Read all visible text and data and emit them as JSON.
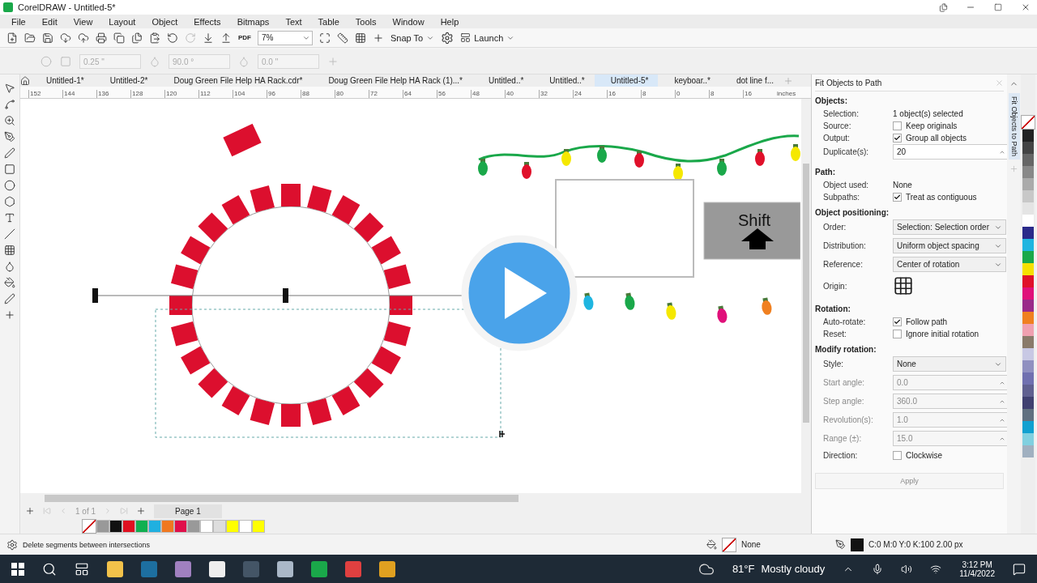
{
  "window": {
    "title": "CorelDRAW - Untitled-5*"
  },
  "menu": [
    "File",
    "Edit",
    "View",
    "Layout",
    "Object",
    "Effects",
    "Bitmaps",
    "Text",
    "Table",
    "Tools",
    "Window",
    "Help"
  ],
  "toolbar": {
    "pdf_label": "PDF",
    "zoom": "7%",
    "snap": "Snap To",
    "launch": "Launch"
  },
  "property_bar": {
    "outline_width": "0.25 \"",
    "angle": "90.0 °",
    "offset": "0.0 \""
  },
  "document_tabs": [
    {
      "label": "Untitled-1*",
      "selected": false
    },
    {
      "label": "Untitled-2*",
      "selected": false
    },
    {
      "label": "Doug Green File Help HA Rack.cdr*",
      "selected": false
    },
    {
      "label": "Doug Green File Help HA Rack (1)...*",
      "selected": false
    },
    {
      "label": "Untitled..*",
      "selected": false
    },
    {
      "label": "Untitled..*",
      "selected": false
    },
    {
      "label": "Untitled-5*",
      "selected": true
    },
    {
      "label": "keyboar..*",
      "selected": false
    },
    {
      "label": "dot line f...",
      "selected": false
    }
  ],
  "ruler": {
    "labels": [
      "152",
      "144",
      "136",
      "128",
      "120",
      "112",
      "104",
      "96",
      "88",
      "80",
      "72",
      "64",
      "56",
      "48",
      "40",
      "32",
      "24",
      "16",
      "8",
      "0",
      "8",
      "16"
    ],
    "unit": "inches"
  },
  "canvas": {
    "key_label": "Shift"
  },
  "page_nav": {
    "pages": "1 of 1",
    "page_tab": "Page 1"
  },
  "document_palette": [
    {
      "color": "#999999"
    },
    {
      "color": "#111111"
    },
    {
      "color": "#e01020"
    },
    {
      "color": "#10b050"
    },
    {
      "color": "#20b0e0"
    },
    {
      "color": "#f07820"
    },
    {
      "color": "#e0104a"
    },
    {
      "color": "#999999"
    },
    {
      "color": "#ffffff"
    },
    {
      "color": "#dddddd"
    },
    {
      "color": "#ffff00"
    },
    {
      "color": "#ffffff"
    },
    {
      "color": "#ffff00"
    }
  ],
  "docker": {
    "title": "Fit Objects to Path",
    "tab_label": "Fit Objects to Path",
    "apply": "Apply",
    "sections": [
      {
        "title": "Objects:",
        "rows": [
          {
            "kind": "text",
            "label": "Selection:",
            "value": "1 object(s) selected"
          },
          {
            "kind": "checkbox",
            "label": "Source:",
            "value": "Keep originals",
            "checked": false
          },
          {
            "kind": "checkbox",
            "label": "Output:",
            "value": "Group all objects",
            "checked": true
          },
          {
            "kind": "spin",
            "label": "Duplicate(s):",
            "value": "20",
            "disabled": false
          }
        ]
      },
      {
        "title": "Path:",
        "rows": [
          {
            "kind": "text",
            "label": "Object used:",
            "value": "None"
          },
          {
            "kind": "checkbox",
            "label": "Subpaths:",
            "value": "Treat as contiguous",
            "checked": true
          }
        ]
      },
      {
        "title": "Object positioning:",
        "rows": [
          {
            "kind": "select",
            "label": "Order:",
            "value": "Selection: Selection order"
          },
          {
            "kind": "select",
            "label": "Distribution:",
            "value": "Uniform object spacing"
          },
          {
            "kind": "select",
            "label": "Reference:",
            "value": "Center of rotation"
          },
          {
            "kind": "origin",
            "label": "Origin:"
          }
        ]
      },
      {
        "title": "Rotation:",
        "rows": [
          {
            "kind": "checkbox",
            "label": "Auto-rotate:",
            "value": "Follow path",
            "checked": true
          },
          {
            "kind": "checkbox",
            "label": "Reset:",
            "value": "Ignore initial rotation",
            "checked": false
          }
        ]
      },
      {
        "title": "Modify rotation:",
        "rows": [
          {
            "kind": "select",
            "label": "Style:",
            "value": "None"
          },
          {
            "kind": "spin",
            "label": "Start angle:",
            "value": "0.0",
            "disabled": true
          },
          {
            "kind": "spin",
            "label": "Step angle:",
            "value": "360.0",
            "disabled": true
          },
          {
            "kind": "spin",
            "label": "Revolution(s):",
            "value": "1.0",
            "disabled": true
          },
          {
            "kind": "spin",
            "label": "Range (±):",
            "value": "15.0",
            "disabled": true
          },
          {
            "kind": "checkbox",
            "label": "Direction:",
            "value": "Clockwise",
            "checked": false
          }
        ]
      }
    ]
  },
  "color_palette": [
    {
      "color": "#222222"
    },
    {
      "color": "#444444"
    },
    {
      "color": "#666666"
    },
    {
      "color": "#888888"
    },
    {
      "color": "#aaaaaa"
    },
    {
      "color": "#c8c8c8"
    },
    {
      "color": "#e4e4e4"
    },
    {
      "color": "#ffffff"
    },
    {
      "color": "#2a2a8a"
    },
    {
      "color": "#1fb5e0"
    },
    {
      "color": "#1aa84a"
    },
    {
      "color": "#f5e000"
    },
    {
      "color": "#e0102a"
    },
    {
      "color": "#e0107a"
    },
    {
      "color": "#9a2a8a"
    },
    {
      "color": "#f08020"
    },
    {
      "color": "#f0a0b0"
    },
    {
      "color": "#8a7a6a"
    },
    {
      "color": "#c8c8e4"
    },
    {
      "color": "#9090c0"
    },
    {
      "color": "#7070b0"
    },
    {
      "color": "#606090"
    },
    {
      "color": "#404070"
    },
    {
      "color": "#607080"
    },
    {
      "color": "#10a0d0"
    },
    {
      "color": "#80d0e0"
    },
    {
      "color": "#a0b0c0"
    }
  ],
  "status_bar": {
    "hint": "Delete segments between intersections",
    "fill": "None",
    "outline": "C:0 M:0 Y:0 K:100  2.00 px"
  },
  "taskbar": {
    "temperature": "81°F",
    "forecast": "Mostly cloudy",
    "time": "3:12 PM",
    "date": "11/4/2022"
  }
}
